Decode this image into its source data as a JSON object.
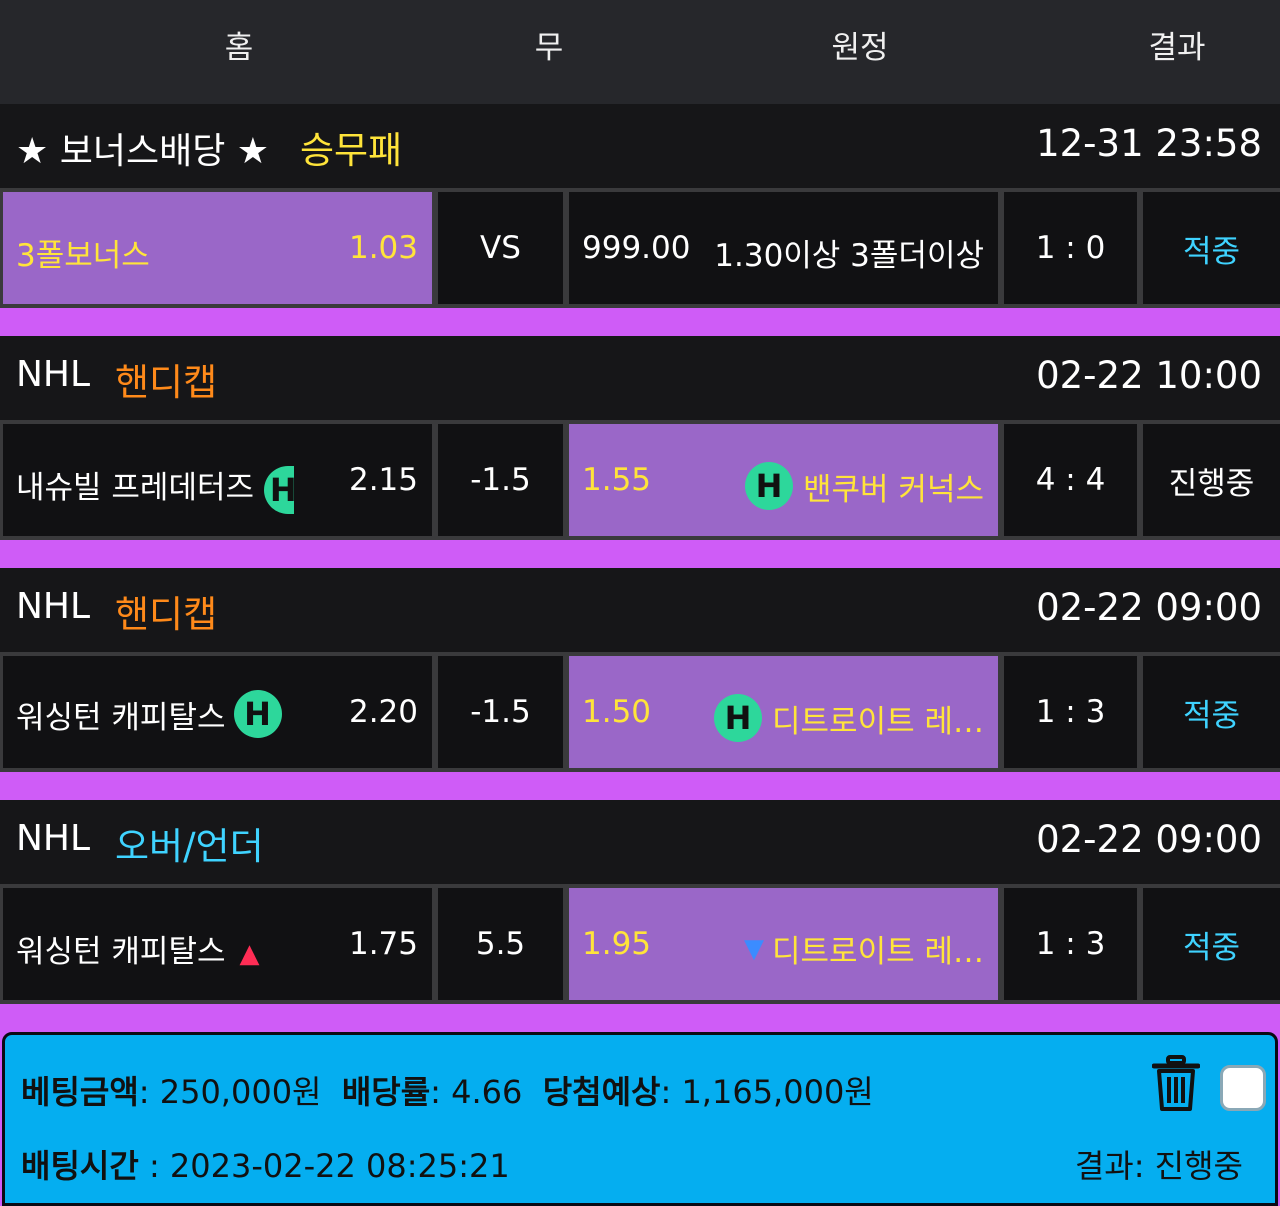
{
  "header": {
    "home": "홈",
    "draw": "무",
    "away": "원정",
    "result": "결과"
  },
  "games": [
    {
      "league": "★ 보너스배당 ★",
      "market": "승무패",
      "market_color": "#ffe43a",
      "datetime": "12-31 23:58",
      "home_name": "3폴보너스",
      "home_odd": "1.03",
      "draw": "VS",
      "away_odd": "999.00",
      "away_name": "1.30이상 3폴더이상",
      "score": "1 : 0",
      "result": "적중",
      "selected": "home"
    },
    {
      "league": "NHL",
      "market": "핸디캡",
      "market_color": "#ff8a1a",
      "datetime": "02-22 10:00",
      "home_name": "내슈빌 프레데터즈",
      "home_badge": "H",
      "home_odd": "2.15",
      "draw": "-1.5",
      "away_odd": "1.55",
      "away_badge": "H",
      "away_name": "밴쿠버 커넉스",
      "score": "4 : 4",
      "result": "진행중",
      "selected": "away"
    },
    {
      "league": "NHL",
      "market": "핸디캡",
      "market_color": "#ff8a1a",
      "datetime": "02-22 09:00",
      "home_name": "워싱턴 캐피탈스",
      "home_badge": "H",
      "home_odd": "2.20",
      "draw": "-1.5",
      "away_odd": "1.50",
      "away_badge": "H",
      "away_name": "디트로이트 레…",
      "score": "1 : 3",
      "result": "적중",
      "selected": "away"
    },
    {
      "league": "NHL",
      "market": "오버/언더",
      "market_color": "#3fd3ff",
      "datetime": "02-22 09:00",
      "home_name": "워싱턴 캐피탈스",
      "home_icon": "▲",
      "home_odd": "1.75",
      "draw": "5.5",
      "away_odd": "1.95",
      "away_icon": "▼",
      "away_name": "디트로이트 레…",
      "score": "1 : 3",
      "result": "적중",
      "selected": "away"
    }
  ],
  "summary": {
    "bet_amount_label": "베팅금액",
    "bet_amount": ": 250,000원",
    "odds_label": "배당률",
    "odds": ": 4.66",
    "expected_label": "당첨예상",
    "expected": ": 1,165,000원",
    "bet_time_label": "배팅시간",
    "bet_time": " : 2023-02-22 08:25:21",
    "result_text": "결과: 진행중",
    "delete_icon": "trash-icon",
    "select_icon": "checkbox"
  }
}
